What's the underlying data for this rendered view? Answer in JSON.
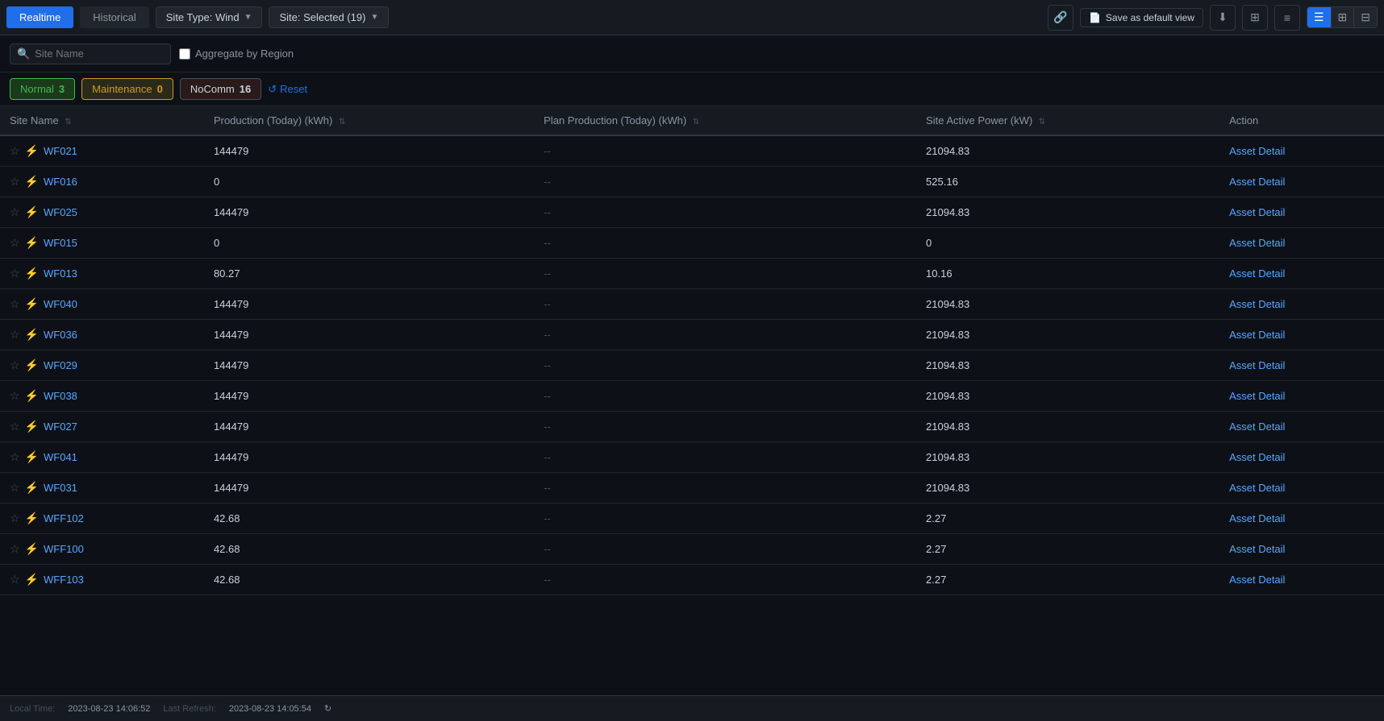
{
  "tabs": {
    "realtime": "Realtime",
    "historical": "Historical"
  },
  "dropdowns": {
    "site_type": "Site Type: Wind",
    "site_selected": "Site: Selected (19)"
  },
  "toolbar": {
    "search_placeholder": "Site Name",
    "aggregate_label": "Aggregate by Region",
    "save_default_label": "Save as default view"
  },
  "filters": {
    "normal_label": "Normal",
    "normal_count": "3",
    "maintenance_label": "Maintenance",
    "maintenance_count": "0",
    "nocomm_label": "NoComm",
    "nocomm_count": "16",
    "reset_label": "Reset"
  },
  "table": {
    "columns": [
      {
        "key": "site_name",
        "label": "Site Name"
      },
      {
        "key": "production",
        "label": "Production (Today) (kWh)"
      },
      {
        "key": "plan_production",
        "label": "Plan Production (Today) (kWh)"
      },
      {
        "key": "active_power",
        "label": "Site Active Power (kW)"
      },
      {
        "key": "action",
        "label": "Action"
      }
    ],
    "rows": [
      {
        "id": "WF021",
        "production": "144479",
        "plan_production": "--",
        "active_power": "21094.83",
        "action": "Asset Detail"
      },
      {
        "id": "WF016",
        "production": "0",
        "plan_production": "--",
        "active_power": "525.16",
        "action": "Asset Detail"
      },
      {
        "id": "WF025",
        "production": "144479",
        "plan_production": "--",
        "active_power": "21094.83",
        "action": "Asset Detail"
      },
      {
        "id": "WF015",
        "production": "0",
        "plan_production": "--",
        "active_power": "0",
        "action": "Asset Detail"
      },
      {
        "id": "WF013",
        "production": "80.27",
        "plan_production": "--",
        "active_power": "10.16",
        "action": "Asset Detail"
      },
      {
        "id": "WF040",
        "production": "144479",
        "plan_production": "--",
        "active_power": "21094.83",
        "action": "Asset Detail"
      },
      {
        "id": "WF036",
        "production": "144479",
        "plan_production": "--",
        "active_power": "21094.83",
        "action": "Asset Detail"
      },
      {
        "id": "WF029",
        "production": "144479",
        "plan_production": "--",
        "active_power": "21094.83",
        "action": "Asset Detail"
      },
      {
        "id": "WF038",
        "production": "144479",
        "plan_production": "--",
        "active_power": "21094.83",
        "action": "Asset Detail"
      },
      {
        "id": "WF027",
        "production": "144479",
        "plan_production": "--",
        "active_power": "21094.83",
        "action": "Asset Detail"
      },
      {
        "id": "WF041",
        "production": "144479",
        "plan_production": "--",
        "active_power": "21094.83",
        "action": "Asset Detail"
      },
      {
        "id": "WF031",
        "production": "144479",
        "plan_production": "--",
        "active_power": "21094.83",
        "action": "Asset Detail"
      },
      {
        "id": "WFF102",
        "production": "42.68",
        "plan_production": "--",
        "active_power": "2.27",
        "action": "Asset Detail"
      },
      {
        "id": "WFF100",
        "production": "42.68",
        "plan_production": "--",
        "active_power": "2.27",
        "action": "Asset Detail"
      },
      {
        "id": "WFF103",
        "production": "42.68",
        "plan_production": "--",
        "active_power": "2.27",
        "action": "Asset Detail"
      }
    ]
  },
  "status_bar": {
    "local_time_label": "Local Time:",
    "local_time_value": "2023-08-23 14:06:52",
    "last_refresh_label": "Last Refresh:",
    "last_refresh_value": "2023-08-23 14:05:54"
  },
  "icons": {
    "search": "🔍",
    "link": "🔗",
    "download": "⬇",
    "layout": "⊞",
    "settings": "☰",
    "list_view": "☰",
    "grid_view_sm": "⊞",
    "grid_view_lg": "⊟",
    "star": "☆",
    "wind_turbine": "⚡",
    "refresh": "↻",
    "reset": "↺",
    "save": "💾",
    "doc": "📄"
  }
}
